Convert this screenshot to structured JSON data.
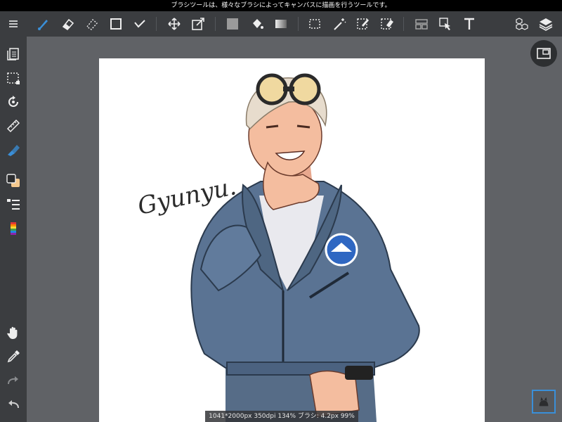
{
  "status": {
    "notice": "ブラシツールは、様々なブラシによってキャンバスに描画を行うツールです。"
  },
  "toolbar": {
    "items": [
      "menu-icon",
      "brush-icon",
      "eraser-icon",
      "blur-eraser-icon",
      "square-shape-icon",
      "select-check-icon",
      "move-icon",
      "transform-icon",
      "fill-color-icon",
      "bucket-icon",
      "gradient-icon",
      "select-rect-icon",
      "magic-wand-icon",
      "select-pen-icon",
      "select-eraser-icon",
      "frame-icon",
      "select-cursor-icon",
      "text-icon",
      "material-icon",
      "layers-icon"
    ]
  },
  "sidebar": {
    "items": [
      "pages-icon",
      "selection-icon",
      "rotate-icon",
      "ruler-icon",
      "fill-icon",
      "color-swap-icon",
      "layer-list-icon",
      "palette-icon",
      "hand-icon",
      "eyedropper-icon",
      "redo-icon",
      "undo-icon"
    ]
  },
  "info": {
    "text": "1041*2000px 350dpi 134% ブラシ: 4.2px 99%"
  },
  "signature": {
    "text": "Gyunyu."
  },
  "colors": {
    "accent": "#3a8fd8",
    "panel": "#3b3d40",
    "bg": "#606266"
  }
}
